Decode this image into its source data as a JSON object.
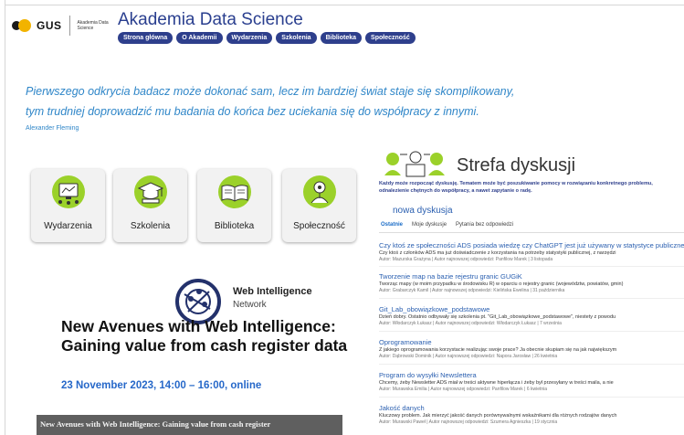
{
  "header": {
    "logo_text": "GUS",
    "logo_sub": "Akademia Data Science",
    "title": "Akademia Data Science",
    "nav": [
      "Strona główna",
      "O Akademii",
      "Wydarzenia",
      "Szkolenia",
      "Biblioteka",
      "Społeczność"
    ]
  },
  "quote": {
    "line1": "Pierwszego odkrycia badacz może dokonać sam, lecz im bardziej świat staje się skomplikowany,",
    "line2": "tym trudniej doprowadzić mu badania do końca bez uciekania się do współpracy z innymi.",
    "author": "Alexander Fleming"
  },
  "tiles": [
    {
      "label": "Wydarzenia",
      "icon": "events-icon"
    },
    {
      "label": "Szkolenia",
      "icon": "graduation-icon"
    },
    {
      "label": "Biblioteka",
      "icon": "book-icon"
    },
    {
      "label": "Społeczność",
      "icon": "community-icon"
    }
  ],
  "event": {
    "logo_name": "Web Intelligence",
    "logo_sub": "Network",
    "title": "New Avenues with Web Intelligence: Gaining value from cash register data",
    "date": "23 November 2023, 14:00 – 16:00, online",
    "banner": "New Avenues with Web Intelligence: Gaining value from cash register"
  },
  "discussion": {
    "title": "Strefa dyskusji",
    "description": "Każdy może rozpocząć dyskusję. Tematem może być poszukiwanie pomocy w rozwiązaniu konkretnego problemu, odnalezienie chętnych do współpracy, a nawet zapytanie o radę.",
    "new_label": "nowa dyskusja",
    "tabs": [
      "Ostatnie",
      "Moje dyskusje",
      "Pytania bez odpowiedzi"
    ],
    "active_tab": "Ostatnie",
    "topics": [
      {
        "title": "Czy ktoś ze społeczności ADS posiada wiedzę czy ChatGPT jest już używany w statystyce publicznej?",
        "excerpt": "Czy ktoś z członków ADS ma już doświadczenie z korzystania na potrzeby statystyki publicznej, z narzędzi",
        "meta": "Autor: Mazurska Grażyna | Autor najnowszej odpowiedzi: Panfilow Marek | 3 listopada"
      },
      {
        "title": "Tworzenie map na bazie rejestru granic GUGiK",
        "excerpt": "Tworząc mapy (w moim przypadku w środowisku R) w oparciu o rejestry granic (województw, powiatów, gmin)",
        "meta": "Autor: Grabarczyk Kamil | Autor najnowszej odpowiedzi: Kielińska Ewelina | 31 października"
      },
      {
        "title": "Git_Lab_obowiązkowe_podstawowe",
        "excerpt": "Dzień dobry. Ostatnio odbywały się szkolenia pt. \"Git_Lab_obowiązkowe_podstawowe\", niestety z powodu",
        "meta": "Autor: Włodarczyk Łukasz | Autor najnowszej odpowiedzi: Włodarczyk Łukasz | 7 września"
      },
      {
        "title": "Oprogramowanie",
        "excerpt": "Z jakiego oprogramowania korzystacie realizując swoje prace? Ja obecnie skupiam się na jak największym",
        "meta": "Autor: Dąbrowski Dominik | Autor najnowszej odpowiedzi: Napora Jarosław | 26 kwietnia"
      },
      {
        "title": "Program do wysyłki Newslettera",
        "excerpt": "Chcemy, żeby Newsletter ADS miał w treści aktywne hiperłącza i żeby był przesyłany w treści maila, a nie",
        "meta": "Autor: Murawska Emilia | Autor najnowszej odpowiedzi: Panfilow Marek | 6 kwietnia"
      },
      {
        "title": "Jakość danych",
        "excerpt": "Kluczowy problem. Jak mierzyć jakość danych porównywalnymi wskaźnikami dla różnych rodzajów danych",
        "meta": "Autor: Murawski Paweł | Autor najnowszej odpowiedzi: Szumera Agnieszka | 19 stycznia"
      }
    ]
  },
  "colors": {
    "nav_bg": "#2e3f8c",
    "quote": "#2f86c8",
    "link": "#2a5fb0",
    "accent_green": "#9bd12a"
  }
}
